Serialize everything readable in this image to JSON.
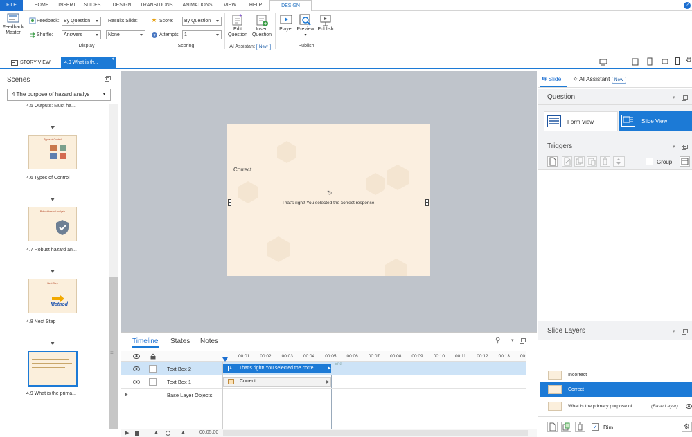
{
  "ribbon": {
    "tabs": [
      "FILE",
      "HOME",
      "INSERT",
      "SLIDES",
      "DESIGN",
      "TRANSITIONS",
      "ANIMATIONS",
      "VIEW",
      "HELP",
      "DESIGN"
    ],
    "feedback_master": [
      "Feedback",
      "Master"
    ],
    "feedback_label": "Feedback:",
    "feedback_value": "By Question",
    "shuffle_label": "Shuffle:",
    "shuffle_value": "Answers",
    "results_slide_label": "Results Slide:",
    "results_slide_value": "None",
    "display_group": "Display",
    "score_label": "Score:",
    "score_value": "By Question",
    "attempts_label": "Attempts:",
    "attempts_value": "1",
    "scoring_group": "Scoring",
    "edit_question": [
      "Edit",
      "Question"
    ],
    "insert_question": [
      "Insert",
      "Question"
    ],
    "ai_assistant_group": "AI Assistant",
    "new_badge": "New",
    "player": "Player",
    "preview": "Preview",
    "publish": "Publish",
    "publish_group": "Publish"
  },
  "doctabs": {
    "story_view": "STORY VIEW",
    "current": "4.9 What is th..."
  },
  "scenes": {
    "title": "Scenes",
    "dropdown": "4 The purpose of hazard analys",
    "captions": [
      "4.5 Outputs: Must ha...",
      "4.6 Types of Control",
      "4.7 Robust hazard an...",
      "4.8 Next Step",
      "4.9 What is the prima..."
    ],
    "thumb_titles": [
      "Types of Control",
      "Robust hazard analysis",
      "Next Step"
    ],
    "method_label": "Method"
  },
  "slide": {
    "correct_label": "Correct",
    "textbox": "That's right!  You selected the correct response."
  },
  "timeline": {
    "tabs": [
      "Timeline",
      "States",
      "Notes"
    ],
    "ticks": [
      "00:01",
      "00:02",
      "00:03",
      "00:04",
      "00:05",
      "00:06",
      "00:07",
      "00:08",
      "00:09",
      "00:10",
      "00:11",
      "00:12",
      "00:13",
      "00:"
    ],
    "rows": [
      {
        "name": "Text Box 2",
        "bar": "That's right! You selected the corre..."
      },
      {
        "name": "Text Box 1",
        "bar": "Correct"
      },
      {
        "name": "Base Layer Objects",
        "bar": ""
      }
    ],
    "end_label": "End",
    "duration": "00:05.00"
  },
  "right": {
    "tab_slide": "Slide",
    "tab_ai": "AI Assistant",
    "new_badge": "New",
    "question_title": "Question",
    "form_view": "Form View",
    "slide_view": "Slide View",
    "triggers_title": "Triggers",
    "group_label": "Group",
    "layers_title": "Slide Layers",
    "layers": [
      {
        "name": "Incorrect",
        "tag": ""
      },
      {
        "name": "Correct",
        "tag": ""
      },
      {
        "name": "What is the primary purpose of ...",
        "tag": "(Base Layer)"
      }
    ],
    "dim_label": "Dim"
  },
  "colors": {
    "accent": "#1c7ad6",
    "slide_bg": "#fbefe0",
    "canvas": "#bfc4cb"
  }
}
